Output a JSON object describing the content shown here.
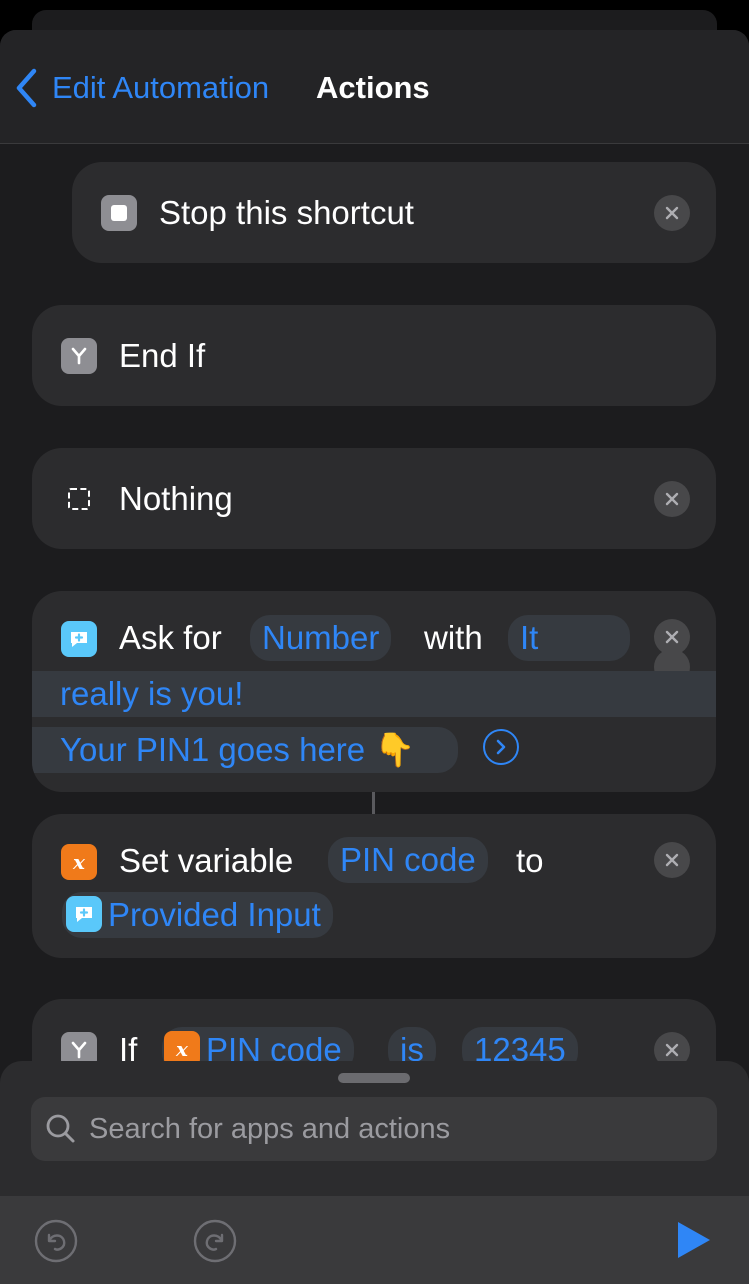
{
  "nav": {
    "back_label": "Edit Automation",
    "title": "Actions"
  },
  "actions": {
    "stop": {
      "label": "Stop this shortcut",
      "icon": "stop-square-icon"
    },
    "end_if": {
      "label": "End If",
      "icon": "branch-icon"
    },
    "nothing": {
      "label": "Nothing",
      "icon": "dashed-square-icon"
    },
    "ask": {
      "prefix": "Ask for",
      "type": "Number",
      "with": "with",
      "prompt_part1": "It",
      "prompt_part2": "really is you!",
      "prompt_part3": "Your PIN1 goes here 👇",
      "icon": "ask-bubble-icon"
    },
    "set_var": {
      "prefix": "Set variable",
      "variable": "PIN code",
      "to": "to",
      "value": "Provided Input",
      "icon": "variable-x-icon"
    },
    "if": {
      "prefix": "If",
      "variable": "PIN code",
      "operator": "is",
      "value": "12345",
      "icon": "branch-icon"
    }
  },
  "search": {
    "placeholder": "Search for apps and actions"
  },
  "toolbar": {
    "undo": "undo-icon",
    "redo": "redo-icon",
    "run": "play-icon"
  },
  "colors": {
    "accent": "#2f86f6",
    "background": "#1c1c1e",
    "card": "#2c2c2e",
    "orange": "#f07a1a",
    "cyan": "#5ac8fa",
    "gray_icon": "#8e8e93"
  }
}
